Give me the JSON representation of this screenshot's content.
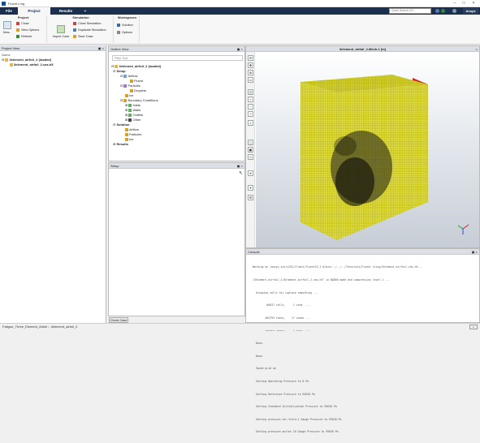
{
  "window": {
    "title": "Fluent Lrng"
  },
  "tabs": [
    {
      "label": "File"
    },
    {
      "label": "Project"
    },
    {
      "label": "Results"
    },
    {
      "label": "+"
    }
  ],
  "search": {
    "placeholder": "Quick Search (Ct..."
  },
  "brand": "Ansys",
  "ribbon": {
    "project": {
      "title": "Project",
      "new_label": "New...",
      "close_label": "Close",
      "view_options_label": "View Options",
      "refresh_label": "Refresh"
    },
    "simulation": {
      "title": "Simulation",
      "close_sim_label": "Close Simulation",
      "import_case_label": "Import Case",
      "duplicate_label": "Duplicate Simulation",
      "save_case_label": "Save Case"
    },
    "workspaces": {
      "title": "Workspaces",
      "solution_label": "Solution",
      "options_label": "Options"
    }
  },
  "project_view": {
    "header": "Project View",
    "root_label": "Name",
    "project_name": "3element_airfoil_2 (loaded)",
    "case_file": "3element_airfoil_2.cas.h5"
  },
  "outline_view": {
    "header": "Outline View",
    "filter_placeholder": "Filter Text",
    "tree": {
      "root": "3element_airfoil_2 (loaded)",
      "setup": "Setup",
      "airflow": "Airflow",
      "fluent": "Fluent",
      "particles": "Particles",
      "droplets": "Droplets",
      "ice": "Ice",
      "boundary_conditions": "Boundary Conditions",
      "inlets": "Inlets",
      "walls": "Walls",
      "outlets": "Outlets",
      "other": "Other",
      "solution": "Solution",
      "sol_airflow": "Airflow",
      "sol_particles": "Particles",
      "sol_ice": "Ice",
      "results": "Results"
    }
  },
  "setup_panel": {
    "header": "Setup"
  },
  "check_case_label": "Check Case",
  "graphics": {
    "title": "3element_airfoil_2.Mesh-1 [m]"
  },
  "console": {
    "header": "Console",
    "lines": [
      "Working on /ansys_inc/v232/fluent/fluent23.2.0/bin/../../../Tutorials/Fluent Icing/3element_airfoil.cas.h5...",
      "/3element_airfoil_2/3element_airfoil_2.cas.h5\" in NODE0 mode and compression level 1 ...",
      "  Grouping cells for Laplace smoothing ...",
      "         80637 cells,     1 zone  ...",
      "        404759 faces,    17 zones ...",
      "        162828 nodes,     1 zone  ...",
      "  Done.",
      "  Done.",
      "  Saved grid ok",
      "  Setting Operating Pressure to 0 Pa",
      "  Setting Reference Pressure to 95630 Pa",
      "  Setting Standard Initialization Pressure to 95630 Pa",
      "  Setting pressure-far-field-1 Gauge Pressure to 95630 Pa",
      "  Setting pressure-outlet-10 Gauge Pressure to 95630 Pa"
    ]
  },
  "status_bar": {
    "path": "Fatigue_Three_Element_Airfoil",
    "sub": "3element_airfoil_2"
  },
  "colors": {
    "tab_bar": "#1b2f4f",
    "mesh_face": "#e6e23a",
    "mesh_side": "#e02020"
  }
}
